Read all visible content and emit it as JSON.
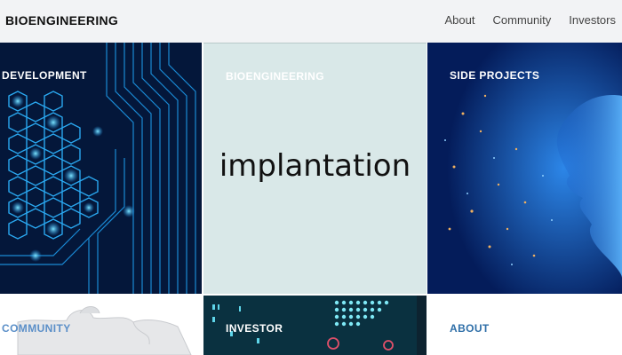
{
  "header": {
    "brand": "BIOENGINEERING",
    "nav": [
      "About",
      "Community",
      "Investors"
    ]
  },
  "tiles": {
    "development": {
      "label": "DEVELOPMENT"
    },
    "bioengineering": {
      "label": "BIOENGINEERING",
      "image_text": "implantation"
    },
    "side_projects": {
      "label": "SIDE PROJECTS"
    },
    "community": {
      "label": "COMMUNITY"
    },
    "investor": {
      "label": "INVESTOR"
    },
    "about": {
      "label": "ABOUT"
    }
  },
  "colors": {
    "navbar_bg": "#f2f3f5",
    "circuit_bg": "#04173a",
    "circuit_line": "#1e9ff0",
    "implant_bg": "#d9e8e8",
    "face_bg": "#041c5a",
    "link_blue": "#2f6fa8"
  }
}
